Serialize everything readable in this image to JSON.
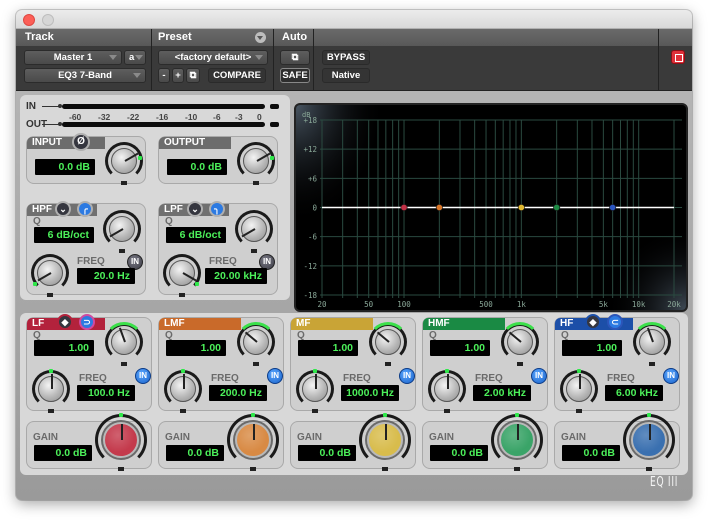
{
  "window": {
    "title": ""
  },
  "header": {
    "track_label": "Track",
    "preset_label": "Preset",
    "auto_label": "Auto",
    "track_name": "Master 1",
    "track_slot": "a",
    "plugin_name": "EQ3 7-Band",
    "preset_name": "<factory default>",
    "preset_minus": "-",
    "preset_plus": "+",
    "compare_label": "COMPARE",
    "safe_label": "SAFE",
    "bypass_label": "BYPASS",
    "native_label": "Native"
  },
  "meters": {
    "in_label": "IN",
    "out_label": "OUT",
    "scale": [
      "-60",
      "-32",
      "-22",
      "-16",
      "-10",
      "-6",
      "-3",
      "0"
    ]
  },
  "input": {
    "label": "INPUT",
    "value": "0.0 dB",
    "phase_icon": "Ø"
  },
  "output": {
    "label": "OUTPUT",
    "value": "0.0 dB"
  },
  "hpf": {
    "label": "HPF",
    "q_label": "Q",
    "q_value": "6 dB/oct",
    "freq_label": "FREQ",
    "freq_value": "20.0 Hz",
    "in_label": "IN",
    "enabled": false
  },
  "lpf": {
    "label": "LPF",
    "q_label": "Q",
    "q_value": "6 dB/oct",
    "freq_label": "FREQ",
    "freq_value": "20.00 kHz",
    "in_label": "IN",
    "enabled": false
  },
  "bands": [
    {
      "label": "LF",
      "color": "#b3223c",
      "knob_color": "#c43a4c",
      "q_label": "Q",
      "q_value": "1.00",
      "freq_label": "FREQ",
      "freq_value": "100.0 Hz",
      "gain_label": "GAIN",
      "gain_value": "0.0 dB",
      "in_label": "IN",
      "enabled": true,
      "has_shape": true
    },
    {
      "label": "LMF",
      "color": "#c96a2a",
      "knob_color": "#d88a44",
      "q_label": "Q",
      "q_value": "1.00",
      "freq_label": "FREQ",
      "freq_value": "200.0 Hz",
      "gain_label": "GAIN",
      "gain_value": "0.0 dB",
      "in_label": "IN",
      "enabled": true,
      "has_shape": false
    },
    {
      "label": "MF",
      "color": "#c9a436",
      "knob_color": "#d8bc4c",
      "q_label": "Q",
      "q_value": "1.00",
      "freq_label": "FREQ",
      "freq_value": "1000.0 Hz",
      "gain_label": "GAIN",
      "gain_value": "0.0 dB",
      "in_label": "IN",
      "enabled": true,
      "has_shape": false
    },
    {
      "label": "HMF",
      "color": "#1a8a44",
      "knob_color": "#3aa468",
      "q_label": "Q",
      "q_value": "1.00",
      "freq_label": "FREQ",
      "freq_value": "2.00 kHz",
      "gain_label": "GAIN",
      "gain_value": "0.0 dB",
      "in_label": "IN",
      "enabled": true,
      "has_shape": false
    },
    {
      "label": "HF",
      "color": "#1c4fa8",
      "knob_color": "#3a70b0",
      "q_label": "Q",
      "q_value": "1.00",
      "freq_label": "FREQ",
      "freq_value": "6.00 kHz",
      "gain_label": "GAIN",
      "gain_value": "0.0 dB",
      "in_label": "IN",
      "enabled": true,
      "has_shape": true
    }
  ],
  "graph": {
    "y_unit": "dB",
    "y_labels": [
      "+18",
      "+12",
      "+6",
      "0",
      "-6",
      "-12",
      "-18"
    ],
    "x_labels": [
      "20",
      "50",
      "100",
      "500",
      "1k",
      "5k",
      "10k",
      "20k"
    ],
    "x_label_values": [
      20,
      50,
      100,
      500,
      1000,
      5000,
      10000,
      20000
    ],
    "y_range": [
      -18,
      18
    ],
    "x_range": [
      20,
      20000
    ],
    "nodes": [
      {
        "band": "LF",
        "freq": 100,
        "gain": 0,
        "color": "#c23045"
      },
      {
        "band": "LMF",
        "freq": 200,
        "gain": 0,
        "color": "#d9772a"
      },
      {
        "band": "MF",
        "freq": 1000,
        "gain": 0,
        "color": "#e0b830"
      },
      {
        "band": "HMF",
        "freq": 2000,
        "gain": 0,
        "color": "#1e8a44"
      },
      {
        "band": "HF",
        "freq": 6000,
        "gain": 0,
        "color": "#2b55c0"
      }
    ]
  },
  "brand": "EQ III"
}
